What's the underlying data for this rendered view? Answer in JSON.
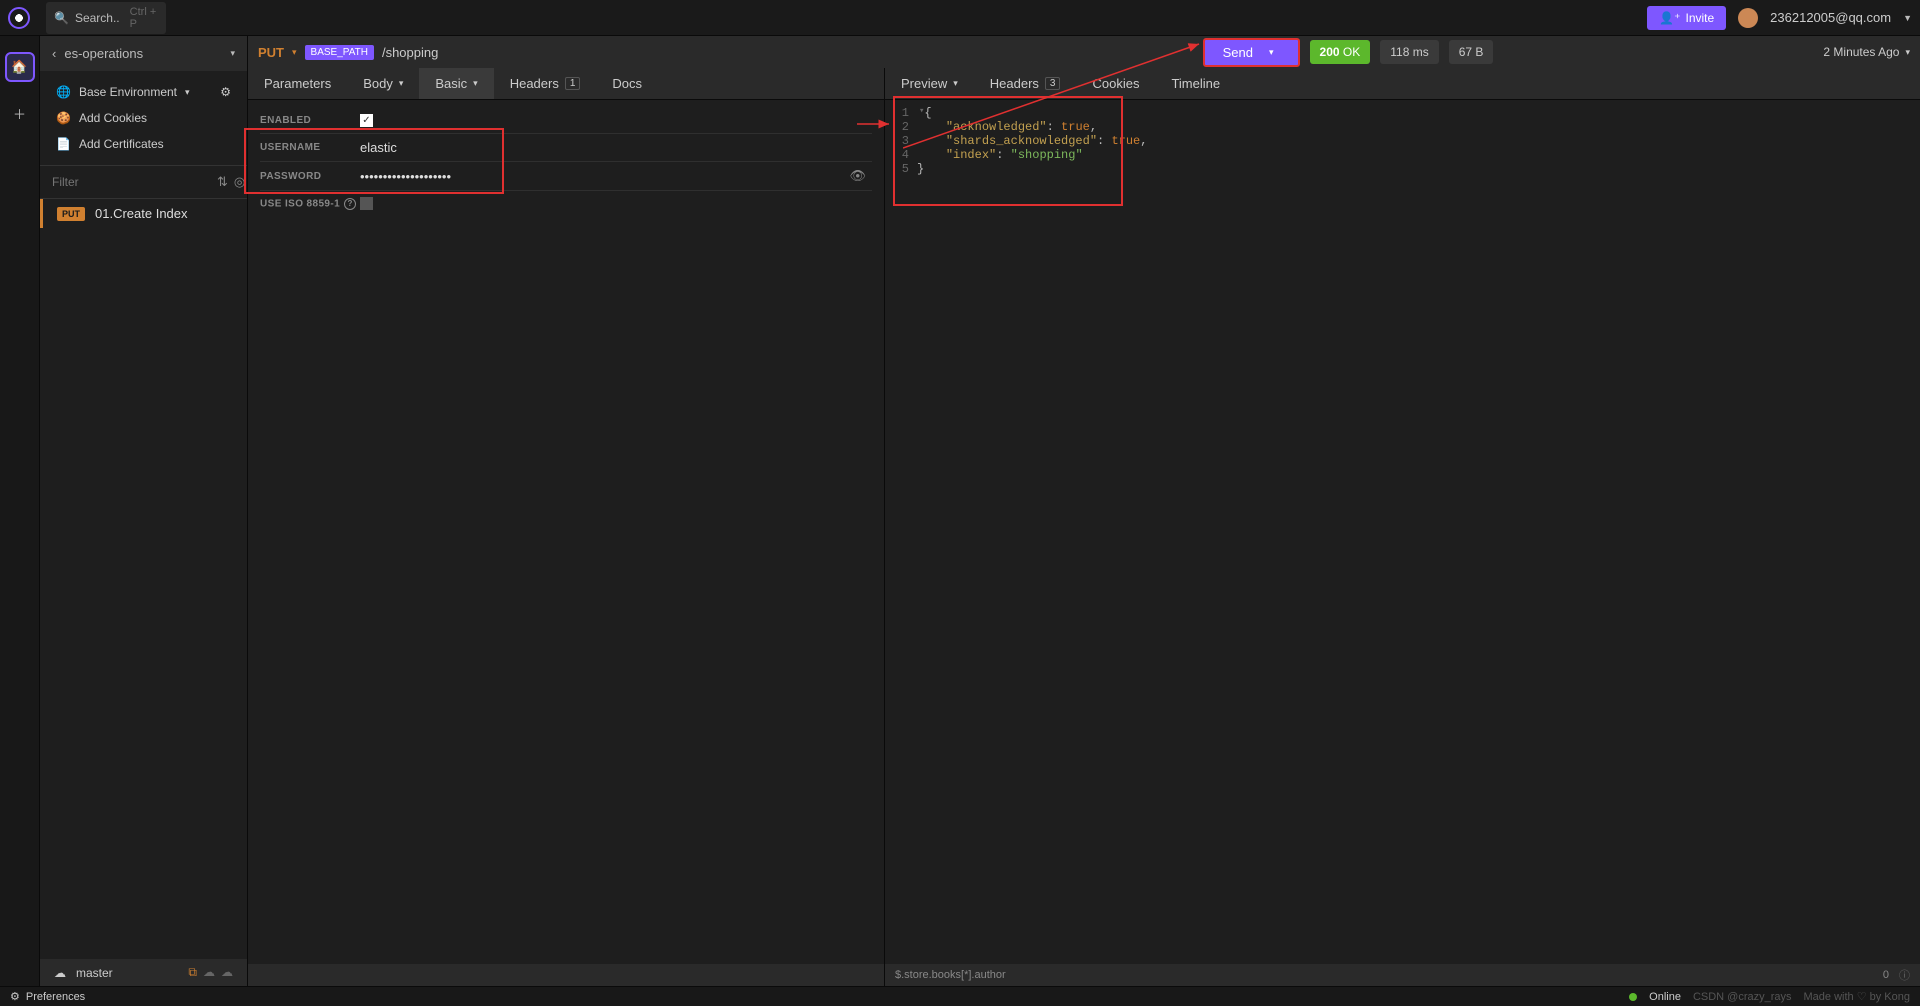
{
  "titlebar": {
    "search_placeholder": "Search..",
    "search_hint": "Ctrl + P",
    "invite": "Invite",
    "user_email": "236212005@qq.com"
  },
  "sidebar": {
    "collection_name": "es-operations",
    "env_name": "Base Environment",
    "add_cookies": "Add Cookies",
    "add_certificates": "Add Certificates",
    "filter_placeholder": "Filter",
    "request_method": "PUT",
    "request_name": "01.Create Index",
    "branch": "master"
  },
  "request": {
    "method": "PUT",
    "basepath_chip": "BASE_PATH",
    "url_path": "/shopping",
    "send": "Send",
    "status_code": "200",
    "status_text": "OK",
    "time": "118 ms",
    "size": "67 B",
    "ago": "2 Minutes Ago"
  },
  "req_tabs": {
    "parameters": "Parameters",
    "body": "Body",
    "basic": "Basic",
    "headers": "Headers",
    "headers_count": "1",
    "docs": "Docs"
  },
  "auth": {
    "enabled_label": "ENABLED",
    "username_label": "USERNAME",
    "username_value": "elastic",
    "password_label": "PASSWORD",
    "password_value": "••••••••••••••••••••",
    "iso_label": "USE ISO 8859-1"
  },
  "res_tabs": {
    "preview": "Preview",
    "headers": "Headers",
    "headers_count": "3",
    "cookies": "Cookies",
    "timeline": "Timeline"
  },
  "response": {
    "k1": "\"acknowledged\"",
    "v1": "true",
    "k2": "\"shards_acknowledged\"",
    "v2": "true",
    "k3": "\"index\"",
    "v3": "\"shopping\"",
    "footer_path": "$.store.books[*].author",
    "footer_count": "0"
  },
  "statusbar": {
    "preferences": "Preferences",
    "online": "Online",
    "watermark": "CSDN @crazy_rays",
    "credit": "Made with ♡ by Kong"
  }
}
